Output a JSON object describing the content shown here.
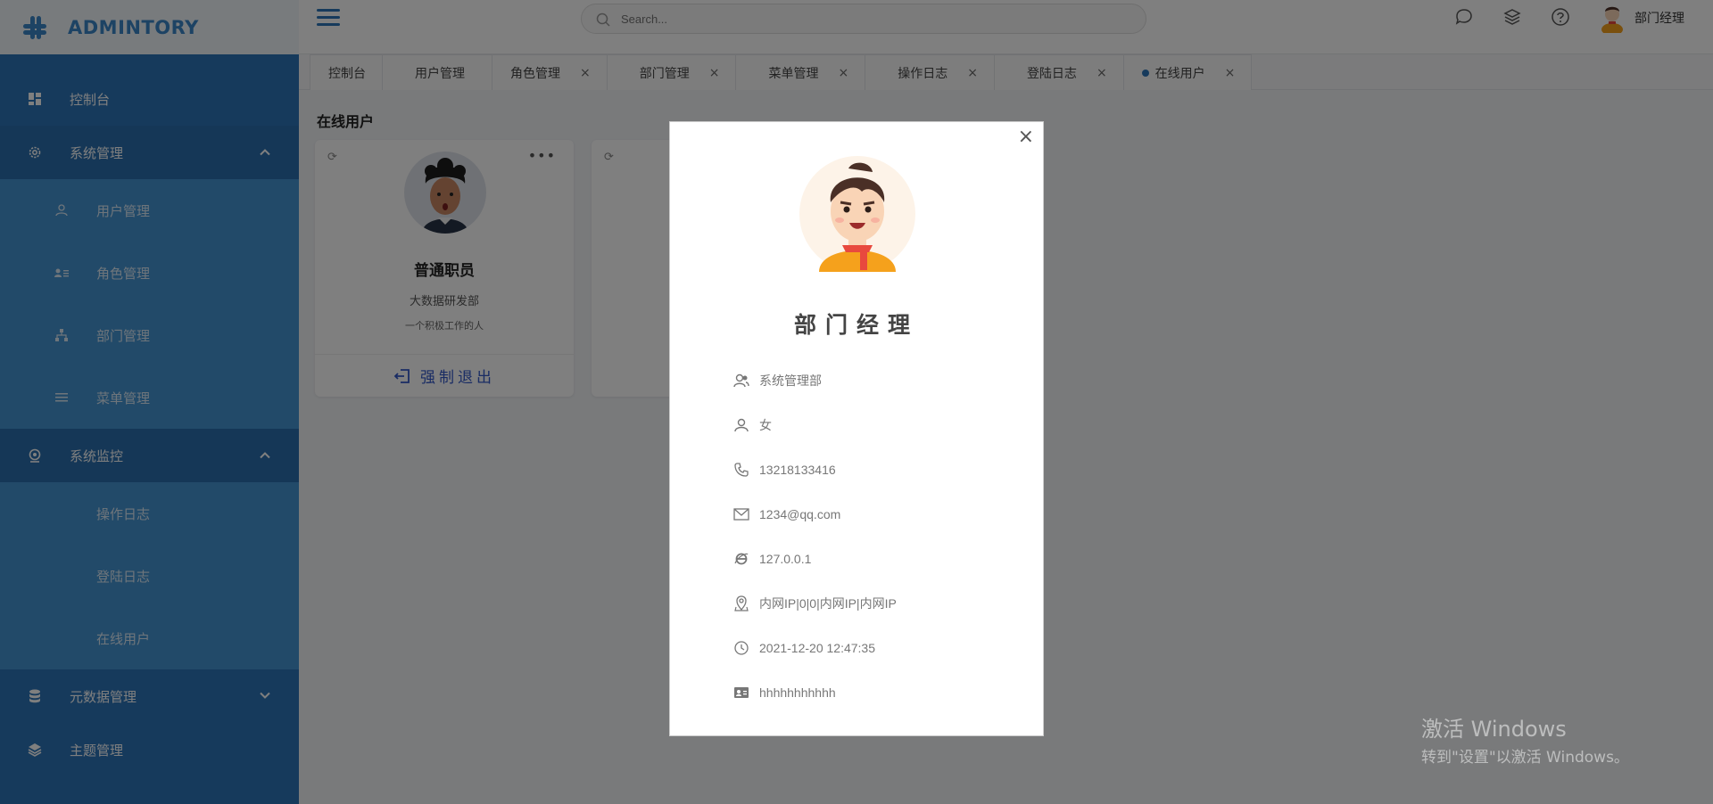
{
  "brand": {
    "title": "ADMINTORY"
  },
  "sidebar": {
    "dashboard": "控制台",
    "system_mgmt": "系统管理",
    "system_items": [
      "用户管理",
      "角色管理",
      "部门管理",
      "菜单管理"
    ],
    "monitor": "系统监控",
    "monitor_items": [
      "操作日志",
      "登陆日志",
      "在线用户"
    ],
    "metadata": "元数据管理",
    "theme": "主题管理"
  },
  "header": {
    "search_placeholder": "Search...",
    "username": "部门经理"
  },
  "tabs": [
    {
      "label": "控制台"
    },
    {
      "label": "用户管理"
    },
    {
      "label": "角色管理",
      "close": "×"
    },
    {
      "label": "部门管理",
      "close": "×"
    },
    {
      "label": "菜单管理",
      "close": "×"
    },
    {
      "label": "操作日志",
      "close": "×"
    },
    {
      "label": "登陆日志",
      "close": "×"
    },
    {
      "label": "在线用户",
      "close": "×"
    }
  ],
  "page": {
    "title": "在线用户",
    "card": {
      "name": "普通职员",
      "dept": "大数据研发部",
      "desc": "一个积极工作的人",
      "logout": "强制退出"
    }
  },
  "modal": {
    "title": "部门经理",
    "close": "×",
    "department": "系统管理部",
    "gender": "女",
    "phone": "13218133416",
    "email": "1234@qq.com",
    "ip": "127.0.0.1",
    "location": "内网IP|0|0|内网IP|内网IP",
    "login_time": "2021-12-20 12:47:35",
    "note": "hhhhhhhhhhh"
  },
  "watermark": {
    "line1": "激活 Windows",
    "line2": "转到\"设置\"以激活 Windows。"
  },
  "colors": {
    "sidebar": "#2d74b8",
    "submenu": "#4595d2",
    "accent": "#3358c9"
  }
}
